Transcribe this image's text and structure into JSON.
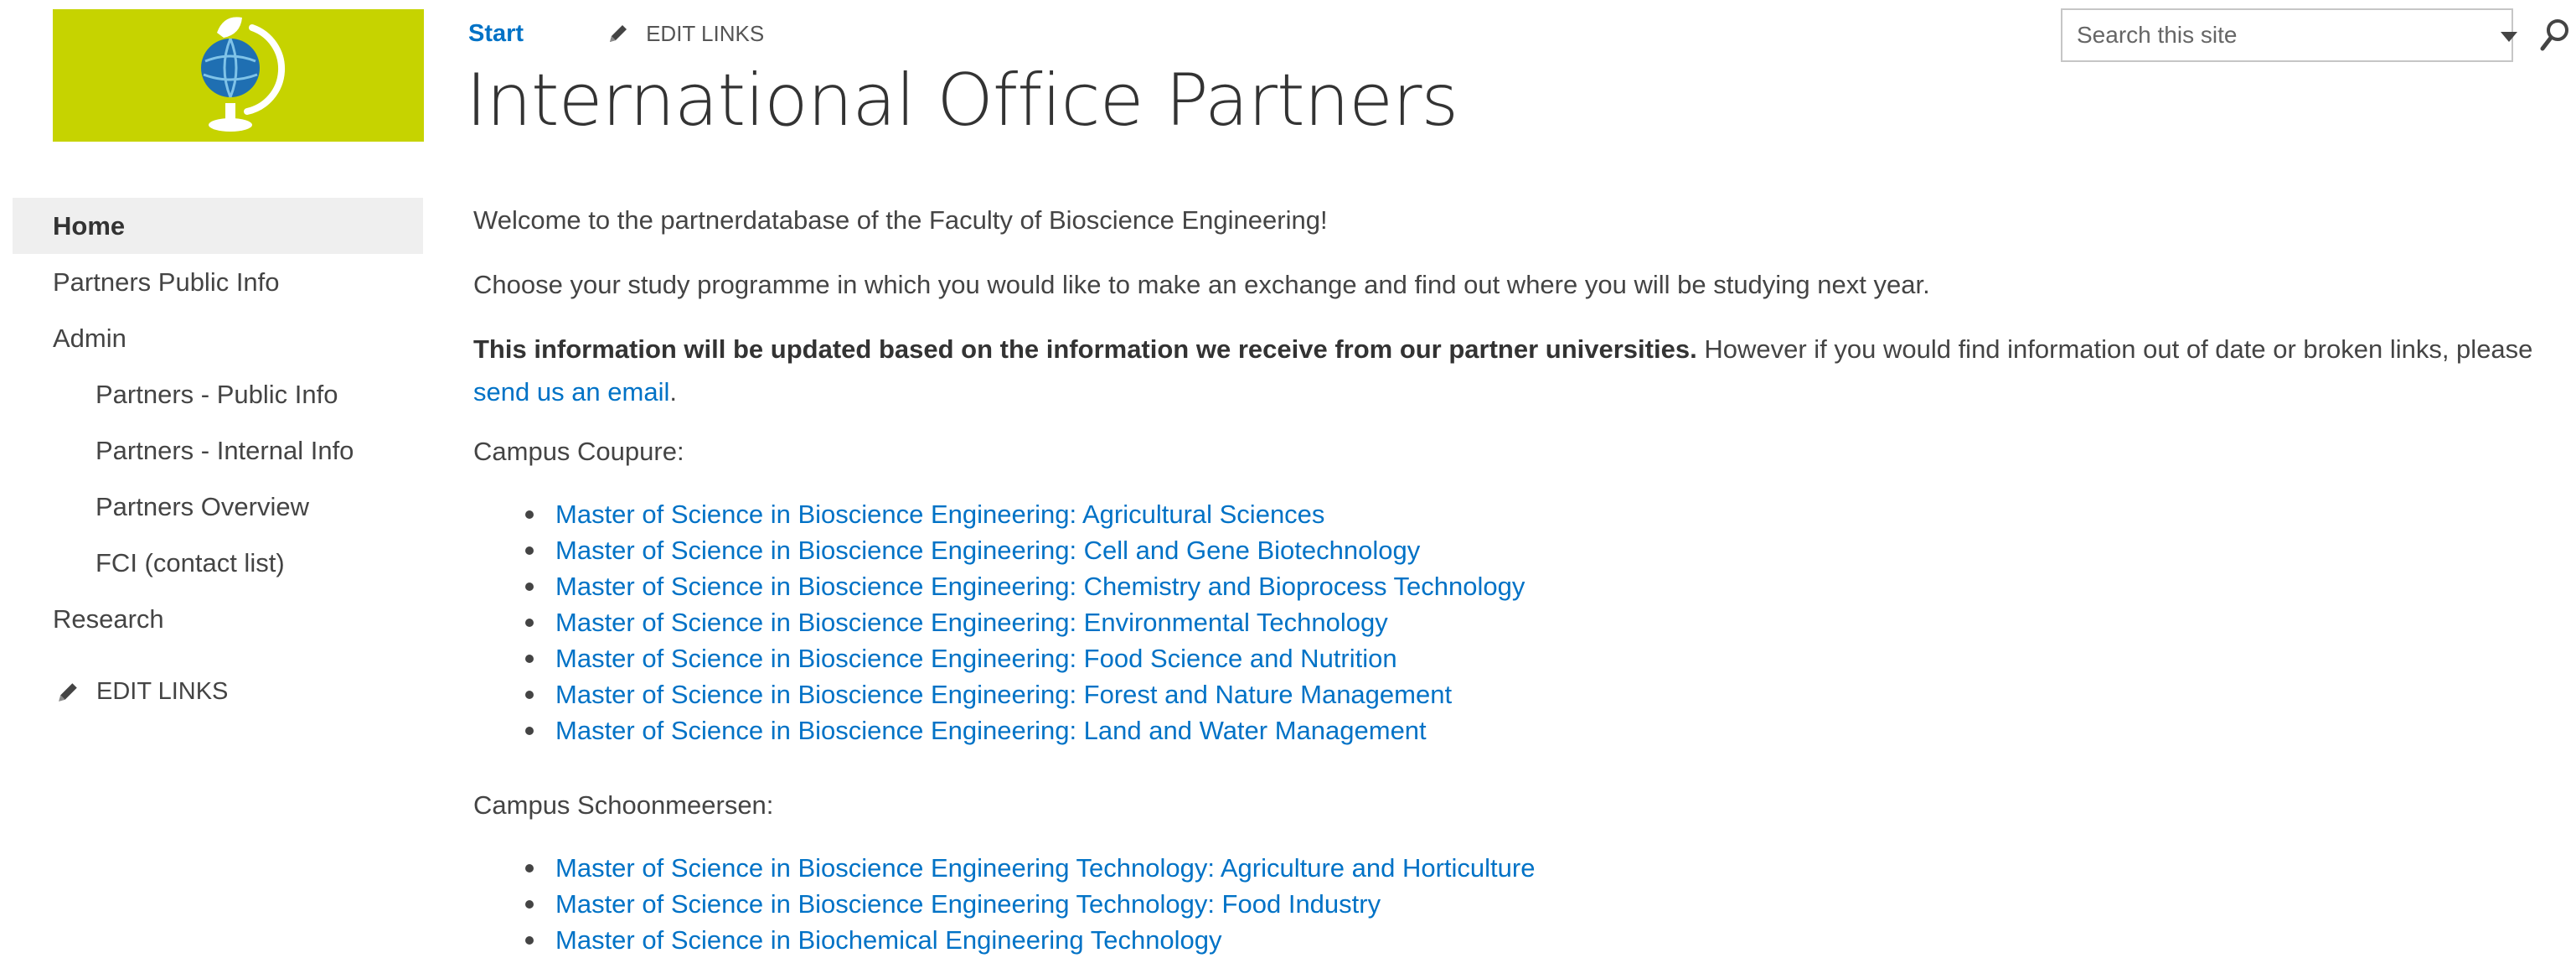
{
  "header": {
    "start_label": "Start",
    "edit_links_label": "EDIT LINKS",
    "title": "International Office Partners"
  },
  "search": {
    "placeholder": "Search this site"
  },
  "sidebar": {
    "items": [
      {
        "label": "Home",
        "selected": true,
        "level": 1
      },
      {
        "label": "Partners Public Info",
        "selected": false,
        "level": 1
      },
      {
        "label": "Admin",
        "selected": false,
        "level": 1
      },
      {
        "label": "Partners - Public Info",
        "selected": false,
        "level": 2
      },
      {
        "label": "Partners - Internal Info",
        "selected": false,
        "level": 2
      },
      {
        "label": "Partners Overview",
        "selected": false,
        "level": 2
      },
      {
        "label": "FCI (contact list)",
        "selected": false,
        "level": 2
      },
      {
        "label": "Research",
        "selected": false,
        "level": 1
      }
    ],
    "edit_links_label": "EDIT LINKS"
  },
  "content": {
    "welcome": "Welcome to the partnerdatabase of the Faculty of Bioscience Engineering!",
    "choose": "Choose your study programme in which you would like to make an exchange and find out where you will be studying next year.",
    "update_bold": "This information will be updated based on the information we receive from our partner universities.",
    "update_rest": " However if you would find information out of date or broken links, please ",
    "email_link": "send us an email",
    "update_end": ".",
    "campus_coupure": {
      "label": "Campus Coupure:",
      "programmes": [
        "Master of Science in Bioscience Engineering: Agricultural Sciences",
        "Master of Science in Bioscience Engineering: Cell and Gene Biotechnology",
        "Master of Science in Bioscience Engineering: Chemistry and Bioprocess Technology",
        "Master of Science in Bioscience Engineering: Environmental Technology",
        "Master of Science in Bioscience Engineering: Food Science and Nutrition",
        "Master of Science in Bioscience Engineering: Forest and Nature Management",
        "Master of Science in Bioscience Engineering: Land and Water Management"
      ]
    },
    "campus_schoonmeersen": {
      "label": "Campus Schoonmeersen:",
      "programmes": [
        "Master of Science in Bioscience Engineering Technology: Agriculture and Horticulture",
        "Master of Science in Bioscience Engineering Technology: Food Industry",
        "Master of Science in Biochemical Engineering Technology"
      ]
    }
  },
  "colors": {
    "logo_background": "#c6d300",
    "link": "#0072c6",
    "text": "#444444",
    "selected_nav_bg": "#efefef"
  },
  "icons": [
    "globe-logo-icon",
    "pencil-icon",
    "dropdown-caret-icon",
    "search-icon"
  ]
}
